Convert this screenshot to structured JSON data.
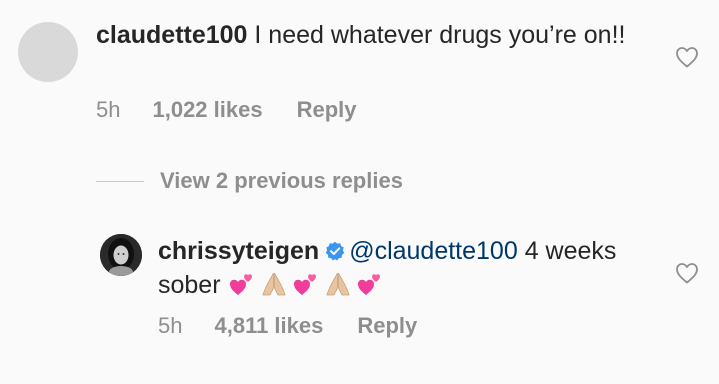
{
  "comment": {
    "username": "claudette100",
    "text": " I need whatever drugs you’re on!!",
    "time": "5h",
    "likes": "1,022 likes",
    "reply_label": "Reply"
  },
  "view_replies": {
    "label": "View 2 previous replies"
  },
  "reply": {
    "username": "chrissyteigen",
    "mention": "@claudette100",
    "text": " 4 weeks sober",
    "time": "5h",
    "likes": "4,811 likes",
    "reply_label": "Reply"
  },
  "icons": {
    "like": "heart-outline-icon",
    "verified": "verified-badge-icon",
    "emoji_1": "two-hearts-emoji",
    "emoji_2": "folded-hands-emoji"
  },
  "colors": {
    "background": "#fafafa",
    "text": "#262626",
    "secondary": "#8e8e8e",
    "verified": "#3897f0",
    "mention": "#00376b",
    "emoji_heart": "#f03c9b",
    "emoji_hands": "#e8c4a0"
  }
}
